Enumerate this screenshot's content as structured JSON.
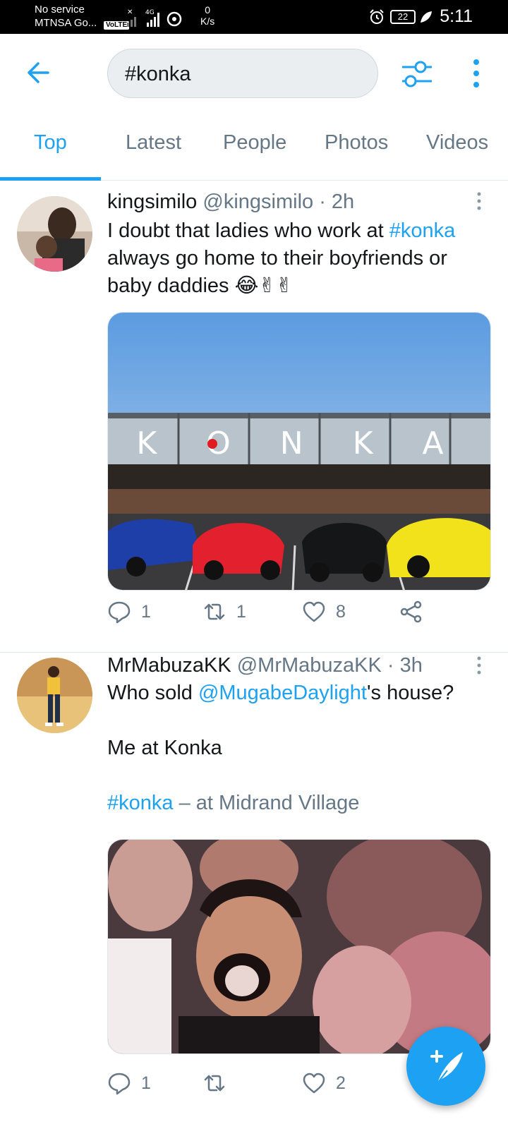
{
  "status_bar": {
    "carrier_line1": "No service",
    "carrier_line2": "MTNSA Go...",
    "volte": "VoLTE",
    "network": "4G",
    "speed_value": "0",
    "speed_unit": "K/s",
    "battery": "22",
    "time": "5:11"
  },
  "search": {
    "query": "#konka"
  },
  "tabs": [
    {
      "label": "Top",
      "active": true
    },
    {
      "label": "Latest",
      "active": false
    },
    {
      "label": "People",
      "active": false
    },
    {
      "label": "Photos",
      "active": false
    },
    {
      "label": "Videos",
      "active": false
    }
  ],
  "tweets": [
    {
      "name": "kingsimilo",
      "handle": "@kingsimilo",
      "time": "· 2h",
      "text_part1": "I doubt that ladies who work at ",
      "hashtag": "#konka",
      "text_part2": " always go home to their boyfriends or baby daddies ",
      "emoji": "😂✌✌",
      "media_sign": "K O N K A",
      "replies": "1",
      "retweets": "1",
      "likes": "8"
    },
    {
      "name": "MrMabuzaKK",
      "handle": "@MrMabuzaKK",
      "time": "· 3h",
      "text_part1": "Who sold ",
      "mention": "@MugabeDaylight",
      "text_part2": "'s house?",
      "line2": "Me at Konka",
      "hashtag": "#konka",
      "location": " – at Midrand Village",
      "replies": "1",
      "retweets": "",
      "likes": "2"
    }
  ],
  "colors": {
    "accent": "#1da1f2",
    "muted": "#657786",
    "text": "#14171a"
  },
  "icons": {
    "back": "arrow-left-icon",
    "filter": "sliders-icon",
    "more": "more-vertical-icon",
    "reply": "reply-icon",
    "retweet": "retweet-icon",
    "like": "heart-icon",
    "share": "share-icon",
    "compose": "compose-tweet-icon"
  }
}
